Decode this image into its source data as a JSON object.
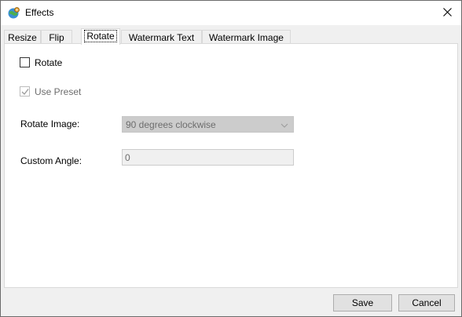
{
  "window": {
    "title": "Effects",
    "app_icon": "globe-gear-icon",
    "close_icon": "close-icon"
  },
  "tabs": [
    {
      "label": "Resize",
      "active": false
    },
    {
      "label": "Flip",
      "active": false
    },
    {
      "label": "Rotate",
      "active": true
    },
    {
      "label": "Watermark Text",
      "active": false
    },
    {
      "label": "Watermark Image",
      "active": false
    }
  ],
  "rotate_page": {
    "rotate_checkbox": {
      "label": "Rotate",
      "checked": false
    },
    "use_preset_checkbox": {
      "label": "Use Preset",
      "checked": true,
      "enabled": false
    },
    "rotate_image": {
      "label": "Rotate Image:",
      "value": "90 degrees clockwise",
      "enabled": false
    },
    "custom_angle": {
      "label": "Custom Angle:",
      "value": "0",
      "enabled": false
    }
  },
  "footer": {
    "save_label": "Save",
    "cancel_label": "Cancel"
  }
}
